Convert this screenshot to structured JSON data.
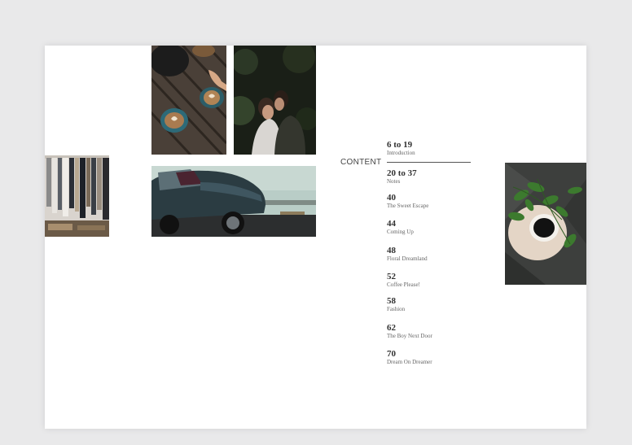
{
  "content_heading": "CONTENT",
  "toc": [
    {
      "page": "6 to 19",
      "title": "Introduction"
    },
    {
      "page": "20 to 37",
      "title": "Notes"
    },
    {
      "page": "40",
      "title": "The Sweet Escape"
    },
    {
      "page": "44",
      "title": "Coming Up"
    },
    {
      "page": "48",
      "title": "Floral Dreamland"
    },
    {
      "page": "52",
      "title": "Coffee Please!"
    },
    {
      "page": "58",
      "title": "Fashion"
    },
    {
      "page": "62",
      "title": "The Boy Next Door"
    },
    {
      "page": "70",
      "title": "Dream On Dreamer"
    }
  ],
  "colors": {
    "background": "#e9e9ea",
    "page": "#ffffff",
    "rule": "#555555"
  }
}
